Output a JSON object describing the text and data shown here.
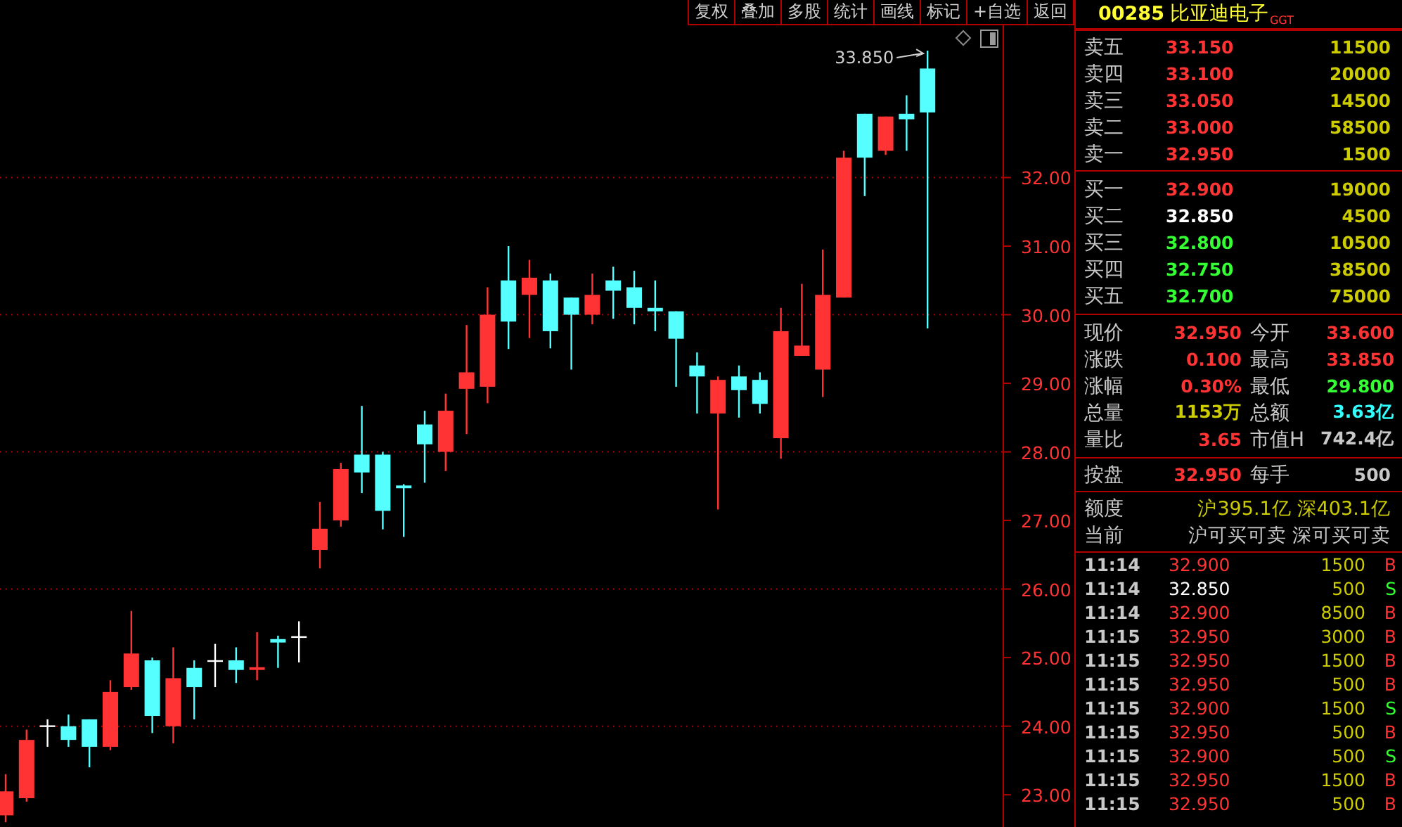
{
  "toolbar": [
    "复权",
    "叠加",
    "多股",
    "统计",
    "画线",
    "标记",
    "+自选",
    "返回"
  ],
  "chart": {
    "chart_data": {
      "type": "candlestick",
      "orientation": "vertical",
      "grid": true,
      "ylim": [
        22.53,
        34.22
      ],
      "yticks": [
        {
          "value": 23,
          "label": "23.00"
        },
        {
          "value": 24,
          "label": "24.00"
        },
        {
          "value": 25,
          "label": "25.00"
        },
        {
          "value": 26,
          "label": "26.00"
        },
        {
          "value": 27,
          "label": "27.00"
        },
        {
          "value": 28,
          "label": "28.00"
        },
        {
          "value": 29,
          "label": "29.00"
        },
        {
          "value": 30,
          "label": "30.00"
        },
        {
          "value": 31,
          "label": "31.00"
        },
        {
          "value": 32,
          "label": "32.00"
        }
      ],
      "ohlc": [
        [
          22.7,
          23.3,
          22.6,
          23.05
        ],
        [
          22.95,
          23.95,
          22.9,
          23.8
        ],
        [
          24.0,
          24.1,
          23.7,
          24.0
        ],
        [
          24.0,
          24.17,
          23.7,
          23.8
        ],
        [
          24.1,
          24.1,
          23.4,
          23.7
        ],
        [
          23.7,
          24.67,
          23.65,
          24.5
        ],
        [
          24.57,
          25.68,
          24.53,
          25.06
        ],
        [
          24.96,
          25.0,
          23.9,
          24.15
        ],
        [
          24.0,
          25.15,
          23.75,
          24.7
        ],
        [
          24.85,
          24.96,
          24.1,
          24.57
        ],
        [
          24.95,
          25.2,
          24.57,
          24.95
        ],
        [
          24.96,
          25.15,
          24.63,
          24.82
        ],
        [
          24.82,
          25.37,
          24.67,
          24.86
        ],
        [
          25.27,
          25.32,
          24.85,
          25.22
        ],
        [
          25.3,
          25.53,
          24.93,
          25.3
        ],
        [
          26.57,
          27.27,
          26.3,
          26.88
        ],
        [
          27.0,
          27.84,
          26.91,
          27.75
        ],
        [
          27.96,
          28.67,
          27.4,
          27.7
        ],
        [
          27.96,
          28.0,
          26.87,
          27.14
        ],
        [
          27.51,
          27.53,
          26.76,
          27.47
        ],
        [
          28.4,
          28.6,
          27.55,
          28.11
        ],
        [
          28.0,
          28.85,
          27.72,
          28.6
        ],
        [
          28.92,
          29.85,
          28.26,
          29.16
        ],
        [
          28.95,
          30.4,
          28.71,
          30.0
        ],
        [
          30.5,
          31.0,
          29.5,
          29.9
        ],
        [
          30.29,
          30.8,
          29.66,
          30.54
        ],
        [
          30.5,
          30.6,
          29.51,
          29.76
        ],
        [
          30.25,
          30.25,
          29.2,
          30.0
        ],
        [
          30.0,
          30.6,
          29.86,
          30.29
        ],
        [
          30.5,
          30.7,
          29.94,
          30.35
        ],
        [
          30.4,
          30.64,
          29.86,
          30.1
        ],
        [
          30.1,
          30.5,
          29.76,
          30.05
        ],
        [
          30.05,
          30.05,
          28.95,
          29.65
        ],
        [
          29.26,
          29.45,
          28.56,
          29.1
        ],
        [
          28.56,
          29.1,
          27.16,
          29.05
        ],
        [
          29.1,
          29.26,
          28.5,
          28.9
        ],
        [
          29.05,
          29.16,
          28.56,
          28.7
        ],
        [
          28.2,
          30.1,
          27.9,
          29.76
        ],
        [
          29.4,
          30.45,
          29.4,
          29.55
        ],
        [
          29.2,
          30.95,
          28.8,
          30.29
        ],
        [
          30.25,
          32.39,
          30.25,
          32.29
        ],
        [
          32.93,
          32.93,
          31.73,
          32.29
        ],
        [
          32.39,
          32.89,
          32.33,
          32.89
        ],
        [
          32.93,
          33.2,
          32.39,
          32.85
        ],
        [
          33.59,
          33.85,
          29.8,
          32.95
        ]
      ],
      "annotations": [
        "33.850"
      ]
    }
  },
  "quote": {
    "code": "00285",
    "name": "比亚迪电子",
    "tag": "GGT",
    "asks": [
      {
        "label": "卖五",
        "price": "33.150",
        "color": "#ff3333",
        "volume": "11500"
      },
      {
        "label": "卖四",
        "price": "33.100",
        "color": "#ff3333",
        "volume": "20000"
      },
      {
        "label": "卖三",
        "price": "33.050",
        "color": "#ff3333",
        "volume": "14500"
      },
      {
        "label": "卖二",
        "price": "33.000",
        "color": "#ff3333",
        "volume": "58500"
      },
      {
        "label": "卖一",
        "price": "32.950",
        "color": "#ff3333",
        "volume": "1500"
      }
    ],
    "bids": [
      {
        "label": "买一",
        "price": "32.900",
        "color": "#ff3333",
        "volume": "19000"
      },
      {
        "label": "买二",
        "price": "32.850",
        "color": "#ffffff",
        "volume": "4500"
      },
      {
        "label": "买三",
        "price": "32.800",
        "color": "#33ff33",
        "volume": "10500"
      },
      {
        "label": "买四",
        "price": "32.750",
        "color": "#33ff33",
        "volume": "38500"
      },
      {
        "label": "买五",
        "price": "32.700",
        "color": "#33ff33",
        "volume": "75000"
      }
    ],
    "stats": [
      {
        "label": "现价",
        "value": "32.950",
        "color": "#ff3333"
      },
      {
        "label": "今开",
        "value": "33.600",
        "color": "#ff3333"
      },
      {
        "label": "涨跌",
        "value": "0.100",
        "color": "#ff3333"
      },
      {
        "label": "最高",
        "value": "33.850",
        "color": "#ff3333"
      },
      {
        "label": "涨幅",
        "value": "0.30%",
        "color": "#ff3333"
      },
      {
        "label": "最低",
        "value": "29.800",
        "color": "#33ff33"
      },
      {
        "label": "总量",
        "value": "1153万",
        "color": "#cccc00"
      },
      {
        "label": "总额",
        "value": "3.63亿",
        "color": "#33ffff"
      },
      {
        "label": "量比",
        "value": "3.65",
        "color": "#ff3333"
      },
      {
        "label": "市值H",
        "value": "742.4亿",
        "color": "#c8c8c8"
      }
    ],
    "board": [
      {
        "label": "按盘",
        "value": "32.950",
        "color": "#ff3333"
      },
      {
        "label": "每手",
        "value": "500",
        "color": "#c8c8c8"
      }
    ],
    "quota": {
      "label": "额度",
      "values": [
        "沪395.1亿",
        "深403.1亿"
      ]
    },
    "current": {
      "label": "当前",
      "values": [
        "沪可买可卖",
        "深可买可卖"
      ]
    },
    "trades": [
      {
        "time": "11:14",
        "price": {
          "text": "32.900",
          "color": "#ff3333"
        },
        "volume": "1500",
        "side": {
          "text": "B",
          "color": "#ff3333"
        }
      },
      {
        "time": "11:14",
        "price": {
          "text": "32.850",
          "color": "#ffffff"
        },
        "volume": "500",
        "side": {
          "text": "S",
          "color": "#33ff33"
        }
      },
      {
        "time": "11:14",
        "price": {
          "text": "32.900",
          "color": "#ff3333"
        },
        "volume": "8500",
        "side": {
          "text": "B",
          "color": "#ff3333"
        }
      },
      {
        "time": "11:15",
        "price": {
          "text": "32.950",
          "color": "#ff3333"
        },
        "volume": "3000",
        "side": {
          "text": "B",
          "color": "#ff3333"
        }
      },
      {
        "time": "11:15",
        "price": {
          "text": "32.950",
          "color": "#ff3333"
        },
        "volume": "1500",
        "side": {
          "text": "B",
          "color": "#ff3333"
        }
      },
      {
        "time": "11:15",
        "price": {
          "text": "32.950",
          "color": "#ff3333"
        },
        "volume": "500",
        "side": {
          "text": "B",
          "color": "#ff3333"
        }
      },
      {
        "time": "11:15",
        "price": {
          "text": "32.900",
          "color": "#ff3333"
        },
        "volume": "1500",
        "side": {
          "text": "S",
          "color": "#33ff33"
        }
      },
      {
        "time": "11:15",
        "price": {
          "text": "32.950",
          "color": "#ff3333"
        },
        "volume": "500",
        "side": {
          "text": "B",
          "color": "#ff3333"
        }
      },
      {
        "time": "11:15",
        "price": {
          "text": "32.900",
          "color": "#ff3333"
        },
        "volume": "500",
        "side": {
          "text": "S",
          "color": "#33ff33"
        }
      },
      {
        "time": "11:15",
        "price": {
          "text": "32.950",
          "color": "#ff3333"
        },
        "volume": "1500",
        "side": {
          "text": "B",
          "color": "#ff3333"
        }
      },
      {
        "time": "11:15",
        "price": {
          "text": "32.950",
          "color": "#ff3333"
        },
        "volume": "500",
        "side": {
          "text": "B",
          "color": "#ff3333"
        }
      }
    ]
  }
}
